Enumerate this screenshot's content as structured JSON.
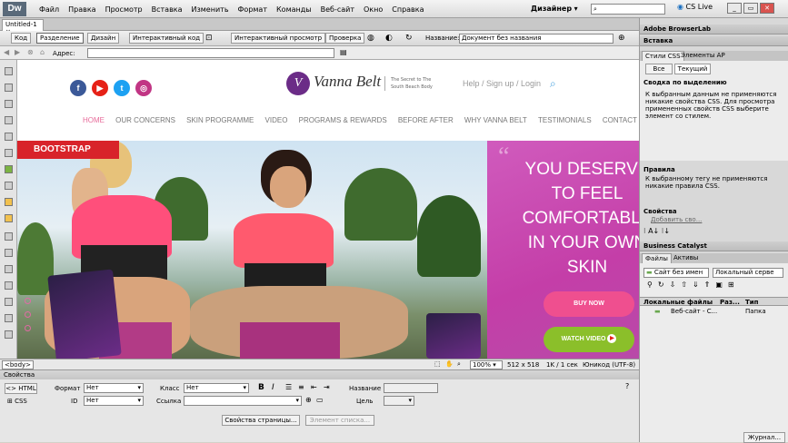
{
  "app": {
    "logo": "Dw",
    "menu": [
      "Файл",
      "Правка",
      "Просмотр",
      "Вставка",
      "Изменить",
      "Формат",
      "Команды",
      "Веб-сайт",
      "Окно",
      "Справка"
    ],
    "workspace": "Дизайнер",
    "cs_live": "CS Live"
  },
  "doc_tab": "Untitled-1",
  "toolbar": {
    "code": "Код",
    "split": "Разделение",
    "design": "Дизайн",
    "live_code": "Интерактивный код",
    "live_view": "Интерактивный просмотр",
    "inspect": "Проверка",
    "title_label": "Название:",
    "title_value": "Документ без названия"
  },
  "address": {
    "label": "Адрес:"
  },
  "site": {
    "tagline": "The Secret to The South Beach Body",
    "brand": "Vanna Belt",
    "brand_mark": "V",
    "top_links": "Help /  Sign up /  Login",
    "nav": [
      "HOME",
      "OUR CONCERNS",
      "SKIN PROGRAMME",
      "VIDEO",
      "PROGRAMS & REWARDS",
      "BEFORE AFTER",
      "WHY VANNA BELT",
      "TESTIMONIALS",
      "CONTACT"
    ],
    "social": [
      "f",
      "▶",
      "t",
      "◎"
    ],
    "bootstrap_label": "BOOTSTRAP",
    "quote_glyph": "“",
    "hero_lines": [
      "YOU DESERVE",
      "TO FEEL",
      "COMFORTABLE",
      "IN YOUR OWN",
      "SKIN"
    ],
    "buy_button": "BUY NOW",
    "watch_button": "WATCH VIDEO"
  },
  "status": {
    "tag": "<body>",
    "zoom": "100%",
    "size": "512 x 518",
    "info": "1K / 1 сек",
    "encoding": "Юникод (UTF-8)"
  },
  "props": {
    "header": "Свойства",
    "html": "HTML",
    "css": "CSS",
    "format_label": "Формат",
    "format_value": "Нет",
    "class_label": "Класс",
    "class_value": "Нет",
    "id_label": "ID",
    "id_value": "Нет",
    "link_label": "Ссылка",
    "name_label": "Название",
    "target_label": "Цель",
    "bold": "B",
    "italic": "I",
    "page_props": "Свойства страницы...",
    "list_item": "Элемент списка..."
  },
  "panels": {
    "browserlab": "Adobe BrowserLab",
    "insert": "Вставка",
    "css_tab": "Стили CSS",
    "ap_tab": "Элементы AP",
    "all_btn": "Все",
    "current_btn": "Текущий",
    "summary_title": "Сводка по выделению",
    "summary_text": "К выбранным данным не применяются никакие свойства CSS.  Для просмотра примененных свойств CSS выберите элемент со стилем.",
    "rules_title": "Правила",
    "rules_text": "К выбранному тегу не применяются никакие правила CSS.",
    "props_title": "Свойства",
    "add_prop": "Добавить сво...",
    "catalyst": "Business Catalyst",
    "files_tab": "Файлы",
    "assets_tab": "Активы",
    "site_select": "Сайт без имен",
    "view_select": "Локальный серве",
    "col_local": "Локальные файлы",
    "col_size": "Раз...",
    "col_type": "Тип",
    "row_name": "Веб-сайт - С...",
    "row_type": "Папка",
    "log": "Журнал..."
  }
}
